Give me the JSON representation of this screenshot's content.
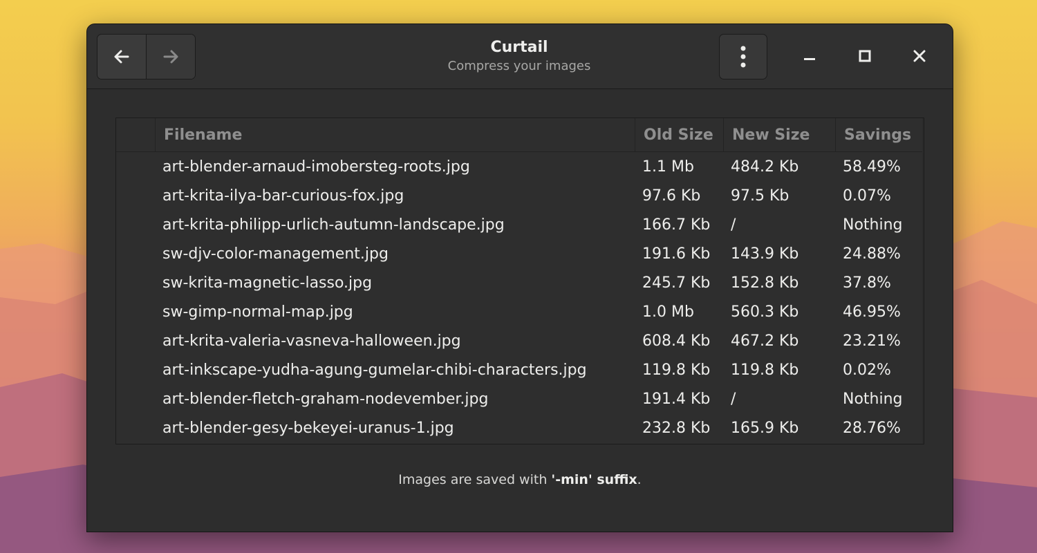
{
  "window": {
    "title": "Curtail",
    "subtitle": "Compress your images"
  },
  "header": {
    "back_icon": "arrow-left-icon",
    "forward_icon": "arrow-right-icon",
    "menu_icon": "vertical-dots-icon",
    "minimize_icon": "minimize-icon",
    "maximize_icon": "maximize-icon",
    "close_icon": "close-icon"
  },
  "table": {
    "columns": [
      "Filename",
      "Old Size",
      "New Size",
      "Savings"
    ],
    "rows": [
      {
        "filename": "art-blender-arnaud-imobersteg-roots.jpg",
        "old": "1.1 Mb",
        "new": "484.2 Kb",
        "savings": "58.49%"
      },
      {
        "filename": "art-krita-ilya-bar-curious-fox.jpg",
        "old": "97.6 Kb",
        "new": "97.5 Kb",
        "savings": "0.07%"
      },
      {
        "filename": "art-krita-philipp-urlich-autumn-landscape.jpg",
        "old": "166.7 Kb",
        "new": "/",
        "savings": "Nothing"
      },
      {
        "filename": "sw-djv-color-management.jpg",
        "old": "191.6 Kb",
        "new": "143.9 Kb",
        "savings": "24.88%"
      },
      {
        "filename": "sw-krita-magnetic-lasso.jpg",
        "old": "245.7 Kb",
        "new": "152.8 Kb",
        "savings": "37.8%"
      },
      {
        "filename": "sw-gimp-normal-map.jpg",
        "old": "1.0 Mb",
        "new": "560.3 Kb",
        "savings": "46.95%"
      },
      {
        "filename": "art-krita-valeria-vasneva-halloween.jpg",
        "old": "608.4 Kb",
        "new": "467.2 Kb",
        "savings": "23.21%"
      },
      {
        "filename": "art-inkscape-yudha-agung-gumelar-chibi-characters.jpg",
        "old": "119.8 Kb",
        "new": "119.8 Kb",
        "savings": "0.02%"
      },
      {
        "filename": "art-blender-fletch-graham-nodevember.jpg",
        "old": "191.4 Kb",
        "new": "/",
        "savings": "Nothing"
      },
      {
        "filename": "art-blender-gesy-bekeyei-uranus-1.jpg",
        "old": "232.8 Kb",
        "new": "165.9 Kb",
        "savings": "28.76%"
      }
    ]
  },
  "footer": {
    "prefix": "Images are saved with ",
    "suffix_bold": "'-min' suffix",
    "end": "."
  },
  "colors": {
    "window_bg": "#2d2d2d",
    "header_bg": "#303030",
    "text": "#eeeeec",
    "muted": "#8f8f8f"
  }
}
